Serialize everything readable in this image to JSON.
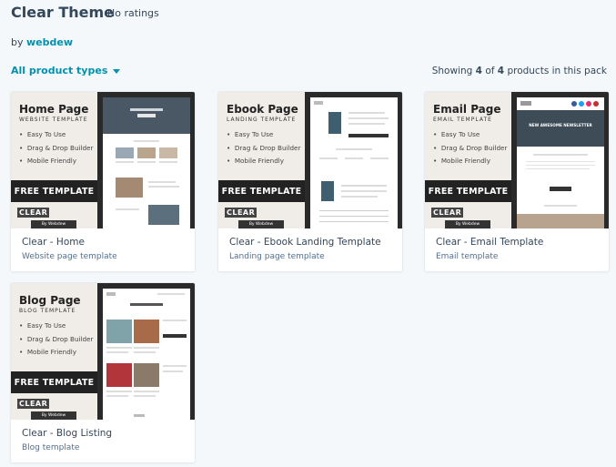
{
  "header": {
    "title": "Clear Theme",
    "ratings": "No ratings",
    "by_prefix": "by",
    "author": "webdew"
  },
  "toolbar": {
    "filter_label": "All product types",
    "showing_prefix": "Showing",
    "showing_count": "4",
    "showing_of": "of",
    "showing_total": "4",
    "showing_suffix": "products in this pack"
  },
  "cards": [
    {
      "title": "Clear - Home",
      "subtitle": "Website page template",
      "thumb_heading": "Home Page",
      "thumb_sub": "WEBSITE TEMPLATE"
    },
    {
      "title": "Clear - Ebook Landing Template",
      "subtitle": "Landing page template",
      "thumb_heading": "Ebook Page",
      "thumb_sub": "LANDING TEMPLATE"
    },
    {
      "title": "Clear - Email Template",
      "subtitle": "Email template",
      "thumb_heading": "Email Page",
      "thumb_sub": "EMAIL TEMPLATE",
      "email_banner": "NEW AWESOME NEWSLETTER"
    },
    {
      "title": "Clear - Blog Listing",
      "subtitle": "Blog template",
      "thumb_heading": "Blog Page",
      "thumb_sub": "BLOG TEMPLATE"
    }
  ],
  "thumb_common": {
    "bullets": [
      "Easy To Use",
      "Drag & Drop Builder",
      "Mobile Friendly"
    ],
    "free": "FREE TEMPLATE",
    "clear": "CLEAR",
    "by": "By Webdew"
  },
  "colors": {
    "accent": "#0091ae",
    "text": "#33475b",
    "background": "#f5f8fa"
  }
}
